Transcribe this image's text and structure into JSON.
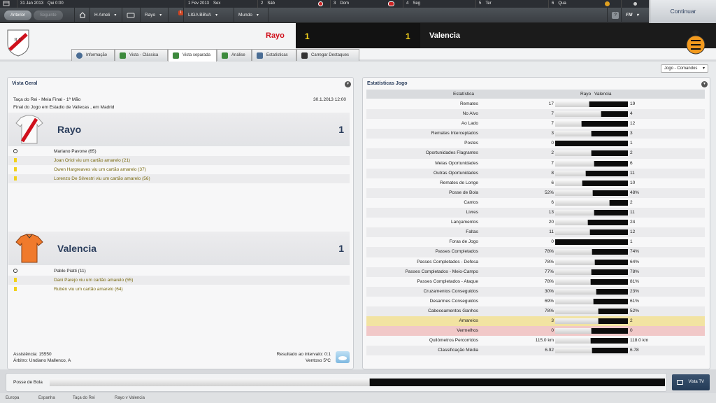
{
  "calendar": {
    "days": [
      {
        "num": "31 Jan 2013",
        "day": "Qui 0:00"
      },
      {
        "num": "1 Fev 2013",
        "day": "Sex"
      },
      {
        "num": "2",
        "day": "Sáb"
      },
      {
        "num": "3",
        "day": "Dom"
      },
      {
        "num": "4",
        "day": "Seg"
      },
      {
        "num": "5",
        "day": "Ter"
      },
      {
        "num": "6",
        "day": "Qua"
      }
    ]
  },
  "nav": {
    "back": "Anterior",
    "forward": "Seguinte",
    "manager": "H Ameli",
    "club": "Rayo",
    "league": "LIGA BBVA",
    "world": "Mundo",
    "notif_count": "1",
    "help": "?",
    "fm": "FM"
  },
  "continue_label": "Continuar",
  "match": {
    "home": "Rayo",
    "away": "Valencia",
    "home_score": "1",
    "away_score": "1"
  },
  "tabs": [
    "Informação",
    "Vista - Clássica",
    "Vista separada",
    "Análise",
    "Estatísticas",
    "Carregar Destaques"
  ],
  "view_select": "Jogo - Comandos",
  "overview": {
    "title": "Vista Geral",
    "competition": "Taça do Rei - Meia Final - 1ª Mão",
    "date": "30.1.2013 12:00",
    "result_line": "Final do Jogo em Estadio de Vallecas , em Madrid",
    "home": {
      "name": "Rayo",
      "score": "1",
      "events": [
        {
          "type": "goal",
          "text": "Mariano Pavone (65)"
        },
        {
          "type": "yellow",
          "text": "Joan Oriol viu um cartão amarelo (21)"
        },
        {
          "type": "yellow",
          "text": "Owen Hargreaves viu um cartão amarelo (37)"
        },
        {
          "type": "yellow",
          "text": "Lorenzo De Silvestri viu um cartão amarelo (56)"
        }
      ]
    },
    "away": {
      "name": "Valencia",
      "score": "1",
      "events": [
        {
          "type": "goal",
          "text": "Pablo Piatti (11)"
        },
        {
          "type": "yellow",
          "text": "Dani Parejo viu um cartão amarelo (55)"
        },
        {
          "type": "yellow",
          "text": "Rubén viu um cartão amarelo (64)"
        }
      ]
    },
    "attendance": "Assistência: 15550",
    "referee": "Árbitro: Undiano Mallenco, A",
    "halftime": "Resultado ao intervalo: 0:1",
    "weather": "Ventoso 5ºC"
  },
  "stats": {
    "title": "Estatísticas Jogo",
    "col_stat": "Estatística",
    "col_home": "Rayo",
    "col_away": "Valencia",
    "rows": [
      {
        "label": "Remates",
        "home": "17",
        "away": "19",
        "h": 17,
        "a": 19
      },
      {
        "label": "No Alvo",
        "home": "7",
        "away": "4",
        "h": 7,
        "a": 4
      },
      {
        "label": "Ao Lado",
        "home": "7",
        "away": "12",
        "h": 7,
        "a": 12
      },
      {
        "label": "Remates Interceptados",
        "home": "3",
        "away": "3",
        "h": 3,
        "a": 3
      },
      {
        "label": "Postes",
        "home": "0",
        "away": "1",
        "h": 0,
        "a": 1
      },
      {
        "label": "Oportunidades Flagrantes",
        "home": "2",
        "away": "2",
        "h": 2,
        "a": 2
      },
      {
        "label": "Meias Oportunidades",
        "home": "7",
        "away": "6",
        "h": 7,
        "a": 6
      },
      {
        "label": "Outras Oportunidades",
        "home": "8",
        "away": "11",
        "h": 8,
        "a": 11
      },
      {
        "label": "Remates de Longe",
        "home": "6",
        "away": "10",
        "h": 6,
        "a": 10
      },
      {
        "label": "Posse de Bola",
        "home": "52%",
        "away": "48%",
        "h": 52,
        "a": 48
      },
      {
        "label": "Cantos",
        "home": "6",
        "away": "2",
        "h": 6,
        "a": 2
      },
      {
        "label": "Livres",
        "home": "13",
        "away": "11",
        "h": 13,
        "a": 11
      },
      {
        "label": "Lançamentos",
        "home": "20",
        "away": "24",
        "h": 20,
        "a": 24
      },
      {
        "label": "Faltas",
        "home": "11",
        "away": "12",
        "h": 11,
        "a": 12
      },
      {
        "label": "Foras de Jogo",
        "home": "0",
        "away": "1",
        "h": 0,
        "a": 1
      },
      {
        "label": "Passes Completados",
        "home": "78%",
        "away": "74%",
        "h": 78,
        "a": 74
      },
      {
        "label": "Passes Completados - Defesa",
        "home": "78%",
        "away": "64%",
        "h": 78,
        "a": 64
      },
      {
        "label": "Passes Completados - Meio-Campo",
        "home": "77%",
        "away": "78%",
        "h": 77,
        "a": 78
      },
      {
        "label": "Passes Completados - Ataque",
        "home": "78%",
        "away": "81%",
        "h": 78,
        "a": 81
      },
      {
        "label": "Cruzamentos Conseguidos",
        "home": "30%",
        "away": "23%",
        "h": 30,
        "a": 23
      },
      {
        "label": "Desarmes Conseguidos",
        "home": "69%",
        "away": "61%",
        "h": 69,
        "a": 61
      },
      {
        "label": "Cabeceamentos Ganhos",
        "home": "78%",
        "away": "52%",
        "h": 78,
        "a": 52
      },
      {
        "label": "Amarelos",
        "home": "3",
        "away": "2",
        "h": 3,
        "a": 2,
        "style": "yellow"
      },
      {
        "label": "Vermelhos",
        "home": "0",
        "away": "0",
        "h": 0,
        "a": 0,
        "style": "red"
      },
      {
        "label": "Quilómetros Percorridos",
        "home": "115.0 km",
        "away": "118.0 km",
        "h": 115,
        "a": 118
      },
      {
        "label": "Classificação Média",
        "home": "6.92",
        "away": "6.78",
        "h": 6.92,
        "a": 6.78
      }
    ]
  },
  "possession": {
    "label": "Posse de Bola",
    "home_pct": 52,
    "away_pct": 48
  },
  "tv_label": "Vista TV",
  "footer": [
    "Europa",
    "Espanha",
    "Taça do Rei",
    "Rayo v Valencia"
  ]
}
